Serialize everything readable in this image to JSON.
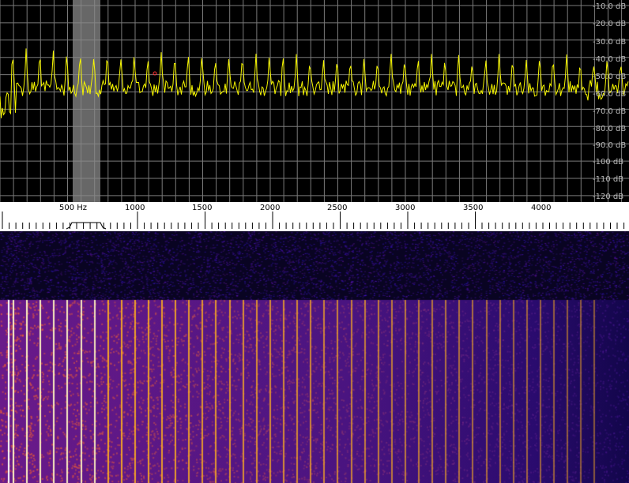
{
  "spectrum": {
    "db_labels": [
      "-10.0 dB",
      "-20.0 dB",
      "-30.0 dB",
      "-40.0 dB",
      "-50.0 dB",
      "-60.0 dB",
      "-70.0 dB",
      "-80.0 dB",
      "-90.0 dB",
      "-100 dB",
      "-110 dB",
      "-120 dB"
    ],
    "trace_color": "#f5f500",
    "grid_color": "#7a7a7a",
    "passband_color": "#8a8a8a"
  },
  "scale": {
    "freq_labels": [
      "500 Hz",
      "1000",
      "1500",
      "2000",
      "2500",
      "3000",
      "3500",
      "4000"
    ]
  },
  "waterfall": {
    "background_color": "#2a0b6e",
    "line_color": "#ffb020"
  }
}
